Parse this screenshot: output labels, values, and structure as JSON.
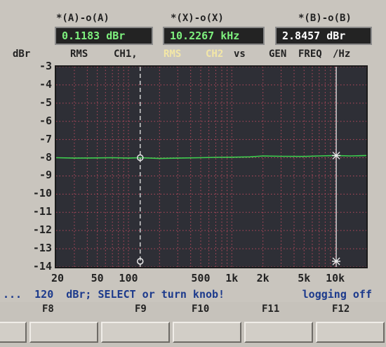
{
  "readouts": [
    {
      "header": "*(A)-o(A)",
      "value": "0.1183 dBr",
      "color": "#7ef07e"
    },
    {
      "header": "*(X)-o(X)",
      "value": "10.2267 kHz",
      "color": "#7ef07e"
    },
    {
      "header": "*(B)-o(B)",
      "value": "2.8457 dBr",
      "color": "#ffffff"
    }
  ],
  "axis_unit_y": "dBr",
  "legend": {
    "rms1": "RMS",
    "ch1": "CH1,",
    "rms2": "RMS",
    "ch2": "CH2",
    "vs": "vs",
    "gen": "GEN",
    "freq": "FREQ",
    "hz": "/Hz"
  },
  "chart_data": {
    "type": "line",
    "ylabel": "dBr",
    "xlabel": "",
    "x_scale": "log",
    "xlim": [
      20,
      20000
    ],
    "ylim": [
      -14,
      -3
    ],
    "y_ticks": [
      "-3",
      "-4",
      "-5",
      "-6",
      "-7",
      "-8",
      "-9",
      "-10",
      "-11",
      "-12",
      "-13",
      "-14"
    ],
    "x_ticks": [
      "20",
      "50",
      "100",
      "500",
      "1k",
      "2k",
      "5k",
      "10k"
    ],
    "series": [
      {
        "color": "#3ecf4f",
        "x": [
          20,
          30,
          50,
          70,
          100,
          130,
          200,
          300,
          500,
          700,
          1000,
          1500,
          2000,
          3000,
          5000,
          7000,
          10000,
          14000,
          20000
        ],
        "y": [
          -8.0,
          -8.02,
          -8.01,
          -8.0,
          -8.02,
          -8.0,
          -8.04,
          -8.02,
          -8.0,
          -7.98,
          -7.97,
          -7.95,
          -7.9,
          -7.92,
          -7.93,
          -7.9,
          -7.88,
          -7.9,
          -7.88
        ]
      }
    ],
    "cursors": [
      {
        "name": "o",
        "x": 130,
        "y": -8.0
      },
      {
        "name": "*",
        "x": 10226.7,
        "y": -7.88
      }
    ]
  },
  "status": {
    "left": "...  120  dBr; SELECT or turn knob!",
    "right": "logging off"
  },
  "function_keys": [
    "F8",
    "F9",
    "F10",
    "F11",
    "F12"
  ]
}
